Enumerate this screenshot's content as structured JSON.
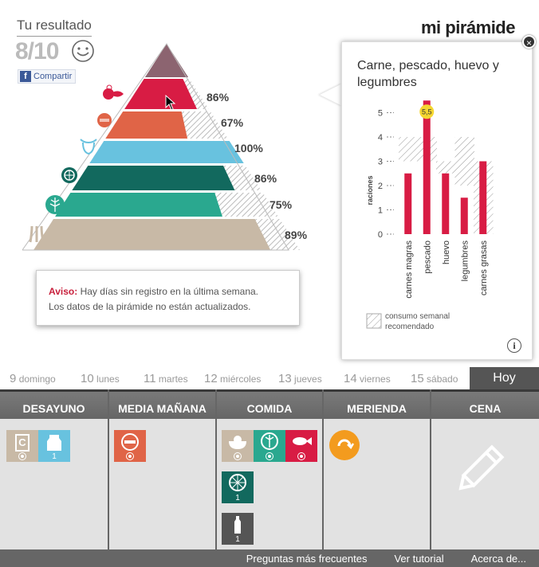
{
  "header": {
    "title": "Tu resultado",
    "score": "8/10",
    "share_label": "Compartir",
    "share_icon": "f",
    "logo": "mi pirámide"
  },
  "pyramid": {
    "levels": [
      {
        "name": "top",
        "color": "#8c6470",
        "percent": null
      },
      {
        "name": "carnes-pescado",
        "color": "#d81c44",
        "percent": "86%",
        "completion": 0.86
      },
      {
        "name": "lacteos",
        "color": "#e06447",
        "percent": "67%",
        "completion": 0.67
      },
      {
        "name": "agua-lacteos",
        "color": "#68c2df",
        "percent": "100%",
        "completion": 1.0
      },
      {
        "name": "frutas",
        "color": "#12695e",
        "percent": "86%",
        "completion": 0.86
      },
      {
        "name": "verduras",
        "color": "#2aa88f",
        "percent": "75%",
        "completion": 0.75
      },
      {
        "name": "cereales",
        "color": "#c8b9a6",
        "percent": "89%",
        "completion": 0.89
      }
    ]
  },
  "popup": {
    "title": "Carne, pescado, huevo y legumbres",
    "close_label": "×",
    "info_label": "i",
    "legend_label": "consumo semanal recomendado"
  },
  "chart_data": {
    "type": "bar",
    "ylabel": "raciones",
    "ylim": [
      0,
      5
    ],
    "yticks": [
      "0",
      "1",
      "2",
      "3",
      "4",
      "5"
    ],
    "categories": [
      "carnes magras",
      "pescado",
      "huevo",
      "legumbres",
      "carnes grasas"
    ],
    "series": [
      {
        "values": [
          2.5,
          5.5,
          2.5,
          1.5,
          3
        ]
      }
    ],
    "recommended_ranges": [
      [
        3,
        4
      ],
      [
        3,
        4
      ],
      [
        2.5,
        3
      ],
      [
        2,
        4
      ],
      [
        0,
        3
      ]
    ],
    "highlight": {
      "category": "pescado",
      "label": "5,5"
    },
    "bar_color": "#d81c44"
  },
  "warning": {
    "label": "Aviso:",
    "line1": " Hay días sin registro en la última semana.",
    "line2": "Los datos de la pirámide no están actualizados."
  },
  "days": [
    {
      "num": "9",
      "name": "domingo"
    },
    {
      "num": "10",
      "name": "lunes"
    },
    {
      "num": "11",
      "name": "martes"
    },
    {
      "num": "12",
      "name": "miércoles"
    },
    {
      "num": "13",
      "name": "jueves"
    },
    {
      "num": "14",
      "name": "viernes"
    },
    {
      "num": "15",
      "name": "sábado"
    }
  ],
  "today_label": "Hoy",
  "meals": {
    "headers": [
      "DESAYUNO",
      "MEDIA MAÑANA",
      "COMIDA",
      "MERIENDA",
      "CENA"
    ],
    "tiles": {
      "desayuno_1": {
        "label": "C",
        "color": "#c8b9a6"
      },
      "desayuno_2": {
        "qty": "1",
        "color": "#68c2df"
      },
      "comida_4": {
        "qty": "1",
        "color": "#12695e"
      },
      "comida_5": {
        "qty": "1",
        "color": "#555555"
      }
    }
  },
  "footer": {
    "faq": "Preguntas más frecuentes",
    "tutorial": "Ver tutorial",
    "about": "Acerca de..."
  }
}
